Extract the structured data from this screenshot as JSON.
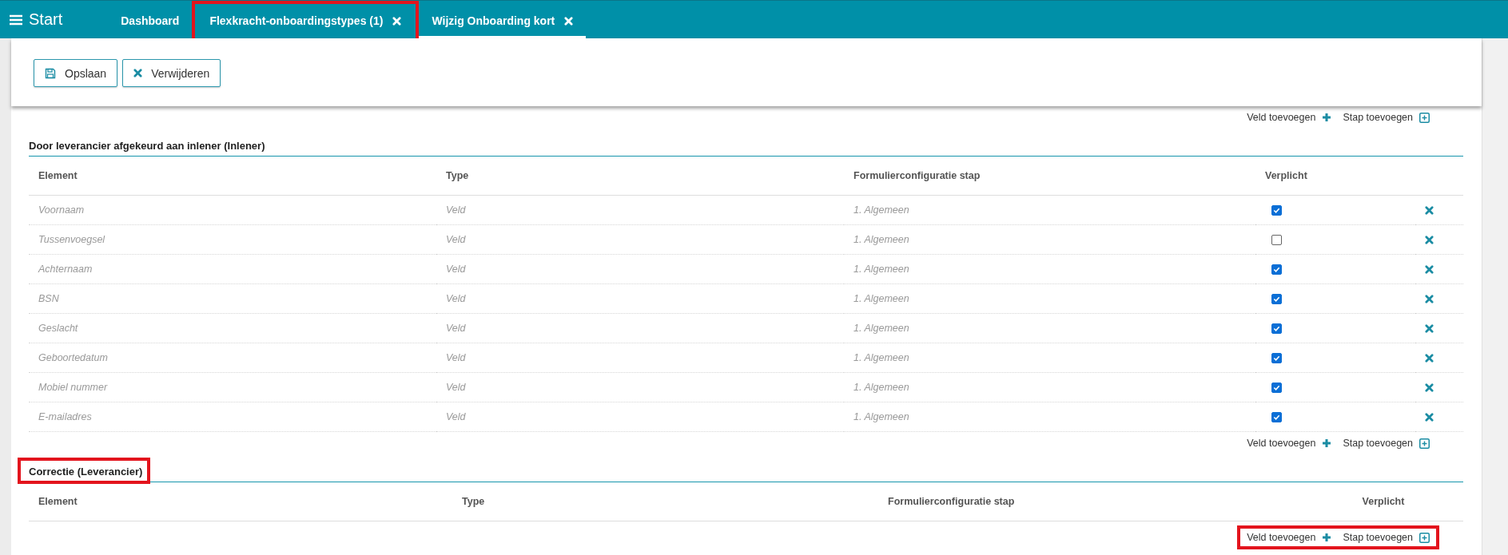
{
  "header": {
    "menu_label": "Start",
    "tabs": [
      {
        "label": "Dashboard",
        "selected": false,
        "closable": false,
        "highlighted": false
      },
      {
        "label": "Flexkracht-onboardingstypes (1)",
        "selected": false,
        "closable": true,
        "highlighted": true
      },
      {
        "label": "Wijzig Onboarding kort",
        "selected": true,
        "closable": true,
        "highlighted": false
      }
    ]
  },
  "toolbar": {
    "buttons": [
      {
        "label": "Opslaan",
        "kind": "save"
      },
      {
        "label": "Verwijderen",
        "kind": "delete"
      }
    ]
  },
  "sections": [
    {
      "top_actions": {
        "add_field": "Veld toevoegen",
        "add_step": "Stap toevoegen",
        "highlighted": false
      },
      "title": "Door leverancier afgekeurd aan inlener (Inlener)",
      "title_highlighted": false,
      "columns": [
        "Element",
        "Type",
        "Formulierconfiguratie stap",
        "Verplicht"
      ],
      "rows": [
        {
          "element": "Voornaam",
          "type": "Veld",
          "step": "1. Algemeen",
          "required": true
        },
        {
          "element": "Tussenvoegsel",
          "type": "Veld",
          "step": "1. Algemeen",
          "required": false
        },
        {
          "element": "Achternaam",
          "type": "Veld",
          "step": "1. Algemeen",
          "required": true
        },
        {
          "element": "BSN",
          "type": "Veld",
          "step": "1. Algemeen",
          "required": true
        },
        {
          "element": "Geslacht",
          "type": "Veld",
          "step": "1. Algemeen",
          "required": true
        },
        {
          "element": "Geboortedatum",
          "type": "Veld",
          "step": "1. Algemeen",
          "required": true
        },
        {
          "element": "Mobiel nummer",
          "type": "Veld",
          "step": "1. Algemeen",
          "required": true
        },
        {
          "element": "E-mailadres",
          "type": "Veld",
          "step": "1. Algemeen",
          "required": true
        }
      ]
    },
    {
      "top_actions": {
        "add_field": "Veld toevoegen",
        "add_step": "Stap toevoegen",
        "highlighted": false
      },
      "title": "Correctie (Leverancier)",
      "title_highlighted": true,
      "columns": [
        "Element",
        "Type",
        "Formulierconfiguratie stap",
        "Verplicht"
      ],
      "bottom_actions": {
        "add_field": "Veld toevoegen",
        "add_step": "Stap toevoegen",
        "highlighted": true
      }
    }
  ]
}
